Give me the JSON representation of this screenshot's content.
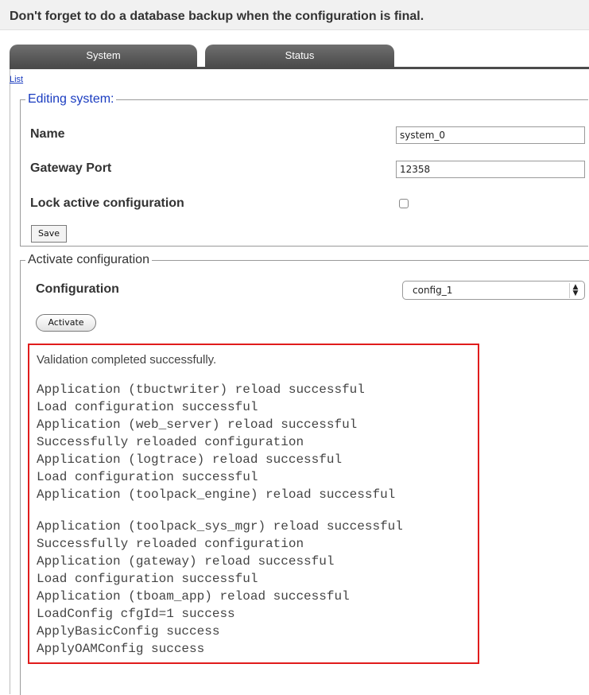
{
  "banner": {
    "text": "Don't forget to do a database backup when the configuration is final."
  },
  "tabs": [
    {
      "label": "System"
    },
    {
      "label": "Status"
    }
  ],
  "nav": {
    "list_link": "List"
  },
  "edit_system": {
    "legend": "Editing system:",
    "name_label": "Name",
    "name_value": "system_0",
    "gateway_port_label": "Gateway Port",
    "gateway_port_value": "12358",
    "lock_label": "Lock active configuration",
    "lock_checked": false,
    "save_label": "Save"
  },
  "activate": {
    "legend": "Activate configuration",
    "configuration_label": "Configuration",
    "configuration_selected": "config_1",
    "activate_label": "Activate"
  },
  "result": {
    "message": "Validation completed successfully.",
    "log_group_1": [
      "Application (tbuctwriter) reload successful",
      "Load configuration successful",
      "Application (web_server) reload successful",
      "Successfully reloaded configuration",
      "Application (logtrace) reload successful",
      "Load configuration successful",
      "Application (toolpack_engine) reload successful"
    ],
    "log_group_2": [
      "Application (toolpack_sys_mgr) reload successful",
      "Successfully reloaded configuration",
      "Application (gateway) reload successful",
      "Load configuration successful",
      "Application (tboam_app) reload successful",
      "LoadConfig cfgId=1 success",
      "ApplyBasicConfig success",
      "ApplyOAMConfig success"
    ]
  },
  "colors": {
    "tab_bg": "#4b4b4b",
    "link": "#1a3cc0",
    "highlight_border": "#e01c1c"
  }
}
